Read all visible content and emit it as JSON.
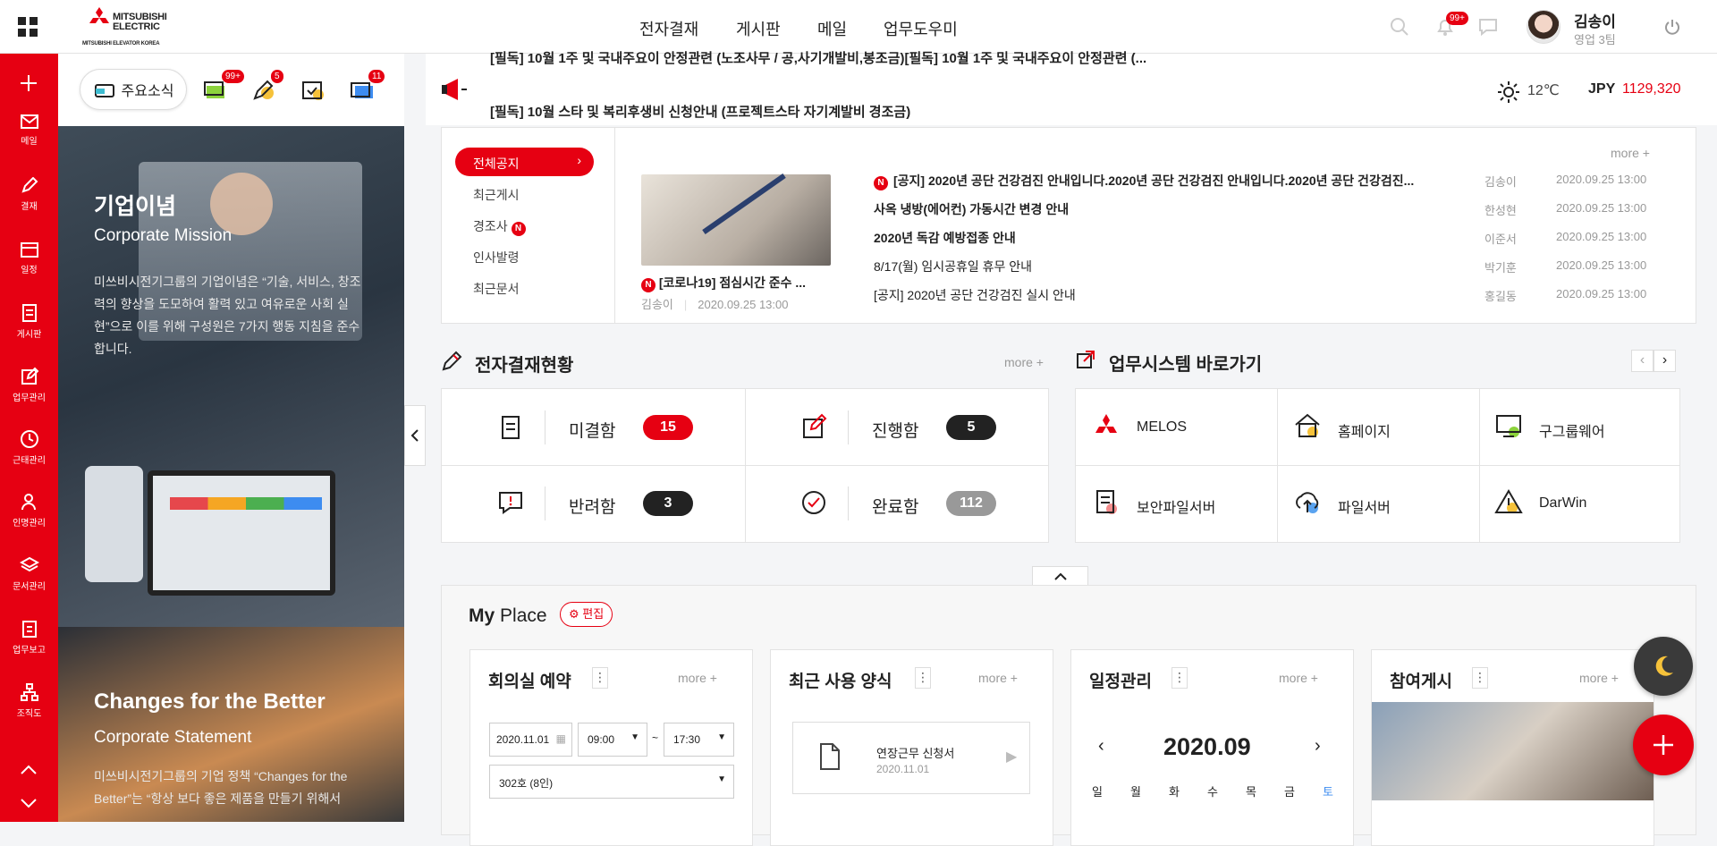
{
  "brand": {
    "name_line1": "MITSUBISHI",
    "name_line2": "ELECTRIC",
    "sub": "MITSUBISHI ELEVATOR KOREA"
  },
  "topnav": [
    "전자결재",
    "게시판",
    "메일",
    "업무도우미"
  ],
  "notif_badge": "99+",
  "user": {
    "name": "김송이",
    "dept": "영업 3팀"
  },
  "sidebar": [
    "메일",
    "결재",
    "일정",
    "게시판",
    "업무관리",
    "근태관리",
    "인명관리",
    "문서관리",
    "업무보고",
    "조직도"
  ],
  "left_tabs": {
    "news_label": "주요소식",
    "badges": [
      "99+",
      "5",
      "",
      "11"
    ]
  },
  "banner1": {
    "title": "기업이념",
    "sub": "Corporate Mission",
    "desc": "미쓰비시전기그룹의 기업이념은 “기술, 서비스, 창조력의 향상을 도모하여 활력 있고 여유로운 사회 실현”으로 이를 위해 구성원은 7가지 행동 지침을 준수합니다."
  },
  "banner2": {
    "title": "Changes for the Better",
    "sub": "Corporate Statement",
    "desc": "미쓰비시전기그룹의 기업 정책 “Changes for the Better”는 “항상 보다 좋은 제품을 만들기 위해서"
  },
  "ticker": {
    "line1": "[필독] 10월 1주 및 국내주요이 안정관련 (노조사무 / 공,사기개발비,봉조금)[필독] 10월 1주 및 국내주요이 안정관련 (...",
    "line2": "[필독] 10월 스타 및 복리후생비 신청안내 (프로젝트스타 자기계발비 경조금)"
  },
  "weather": {
    "temp": "12℃",
    "currency": "JPY",
    "rate": "1129,320"
  },
  "notice": {
    "menu": [
      "전체공지",
      "최근게시",
      "경조사",
      "인사발령",
      "최근문서"
    ],
    "more": "more +",
    "feature": {
      "title": "[코로나19] 점심시간 준수 ...",
      "author": "김송이",
      "date": "2020.09.25 13:00"
    },
    "rows": [
      {
        "new": true,
        "title": "[공지] 2020년 공단 건강검진 안내입니다.2020년 공단 건강검진 안내입니다.2020년 공단 건강검진...",
        "author": "김송이",
        "date": "2020.09.25 13:00",
        "bold": true
      },
      {
        "new": false,
        "title": "사옥 냉방(에어컨) 가동시간 변경 안내",
        "author": "한성현",
        "date": "2020.09.25 13:00",
        "bold": true
      },
      {
        "new": false,
        "title": "2020년 독감 예방접종 안내",
        "author": "이준서",
        "date": "2020.09.25 13:00",
        "bold": true
      },
      {
        "new": false,
        "title": "8/17(월) 임시공휴일 휴무 안내",
        "author": "박기훈",
        "date": "2020.09.25 13:00",
        "bold": false
      },
      {
        "new": false,
        "title": "[공지] 2020년 공단 건강검진 실시 안내",
        "author": "홍길동",
        "date": "2020.09.25 13:00",
        "bold": false
      }
    ]
  },
  "approval": {
    "title": "전자결재현황",
    "more": "more +",
    "items": [
      {
        "label": "미결함",
        "count": "15",
        "color": "#e60012"
      },
      {
        "label": "진행함",
        "count": "5",
        "color": "#222222"
      },
      {
        "label": "반려함",
        "count": "3",
        "color": "#222222"
      },
      {
        "label": "완료함",
        "count": "112",
        "color": "#999999"
      }
    ]
  },
  "shortcuts": {
    "title": "업무시스템 바로가기",
    "items": [
      "MELOS",
      "홈페이지",
      "구그룹웨어",
      "보안파일서버",
      "파일서버",
      "DarWin"
    ]
  },
  "myplace": {
    "title_bold": "My",
    "title_rest": "Place",
    "edit": "편집",
    "cards": [
      {
        "title": "회의실 예약",
        "more": "more +"
      },
      {
        "title": "최근 사용 양식",
        "more": "more +"
      },
      {
        "title": "일정관리",
        "more": "more +"
      },
      {
        "title": "참여게시",
        "more": "more +"
      }
    ],
    "meeting": {
      "date": "2020.11.01",
      "start": "09:00",
      "tilde": "~",
      "end": "17:30",
      "room": "302호 (8인)"
    },
    "form": {
      "name": "연장근무 신청서",
      "date": "2020.11.01"
    },
    "calendar": {
      "month": "2020.09",
      "days": [
        "일",
        "월",
        "화",
        "수",
        "목",
        "금",
        "토"
      ]
    }
  }
}
